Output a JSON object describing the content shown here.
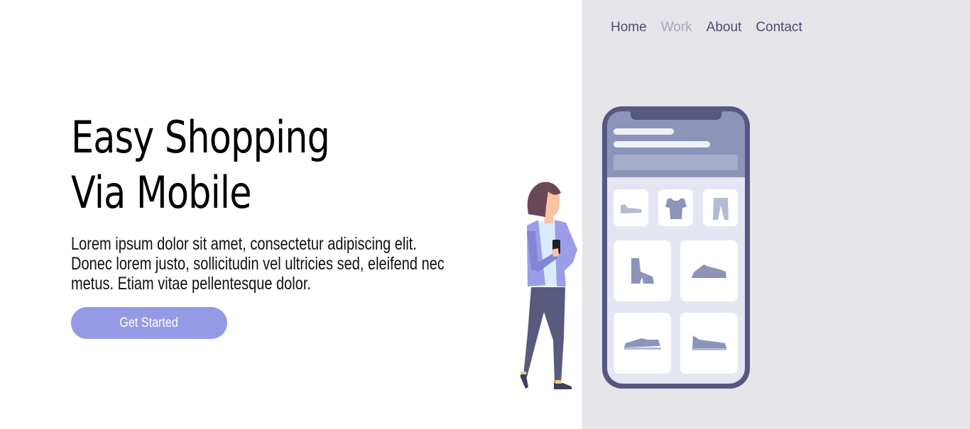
{
  "nav": {
    "items": [
      {
        "label": "Home",
        "active": false
      },
      {
        "label": "Work",
        "active": true
      },
      {
        "label": "About",
        "active": false
      },
      {
        "label": "Contact",
        "active": false
      }
    ]
  },
  "hero": {
    "title_line1": "Easy Shopping",
    "title_line2": "Via Mobile",
    "description": "Lorem ipsum dolor sit amet, consectetur adipiscing elit. Donec lorem justo, sollicitudin vel ultricies sed, eleifend nec metus. Etiam vitae pellentesque dolor.",
    "cta_label": "Get Started"
  },
  "illustration": {
    "icons": [
      "flat-shoe-icon",
      "tshirt-icon",
      "pants-icon",
      "boot-icon",
      "sneaker-icon",
      "sneaker-icon",
      "sneaker-icon"
    ]
  },
  "colors": {
    "accent": "#959ae6",
    "panel_bg": "#e5e4e9",
    "nav_text": "#4b4d72",
    "nav_active": "#a6a8bd",
    "phone_frame": "#575781"
  }
}
